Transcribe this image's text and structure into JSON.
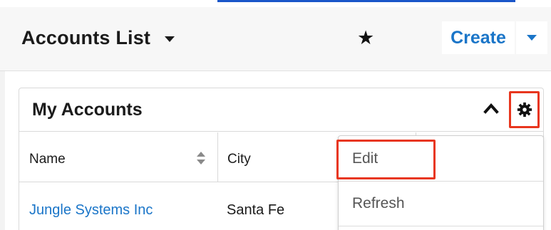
{
  "header": {
    "title": "Accounts List",
    "create_label": "Create"
  },
  "dashlet": {
    "title": "My Accounts",
    "columns": [
      "Name",
      "City"
    ],
    "rows": [
      {
        "name": "Jungle Systems Inc",
        "city": "Santa Fe"
      }
    ]
  },
  "menu": {
    "items": [
      "Edit",
      "Refresh"
    ]
  },
  "colors": {
    "link": "#1a75c8",
    "highlight": "#e8361e",
    "header_bg": "#f7f7f7"
  },
  "icons": {
    "title_dropdown": "caret-down-icon",
    "favorite": "star-icon",
    "create_dropdown": "caret-down-icon",
    "collapse": "chevron-up-icon",
    "settings": "gear-icon",
    "sort": "sort-icon"
  }
}
